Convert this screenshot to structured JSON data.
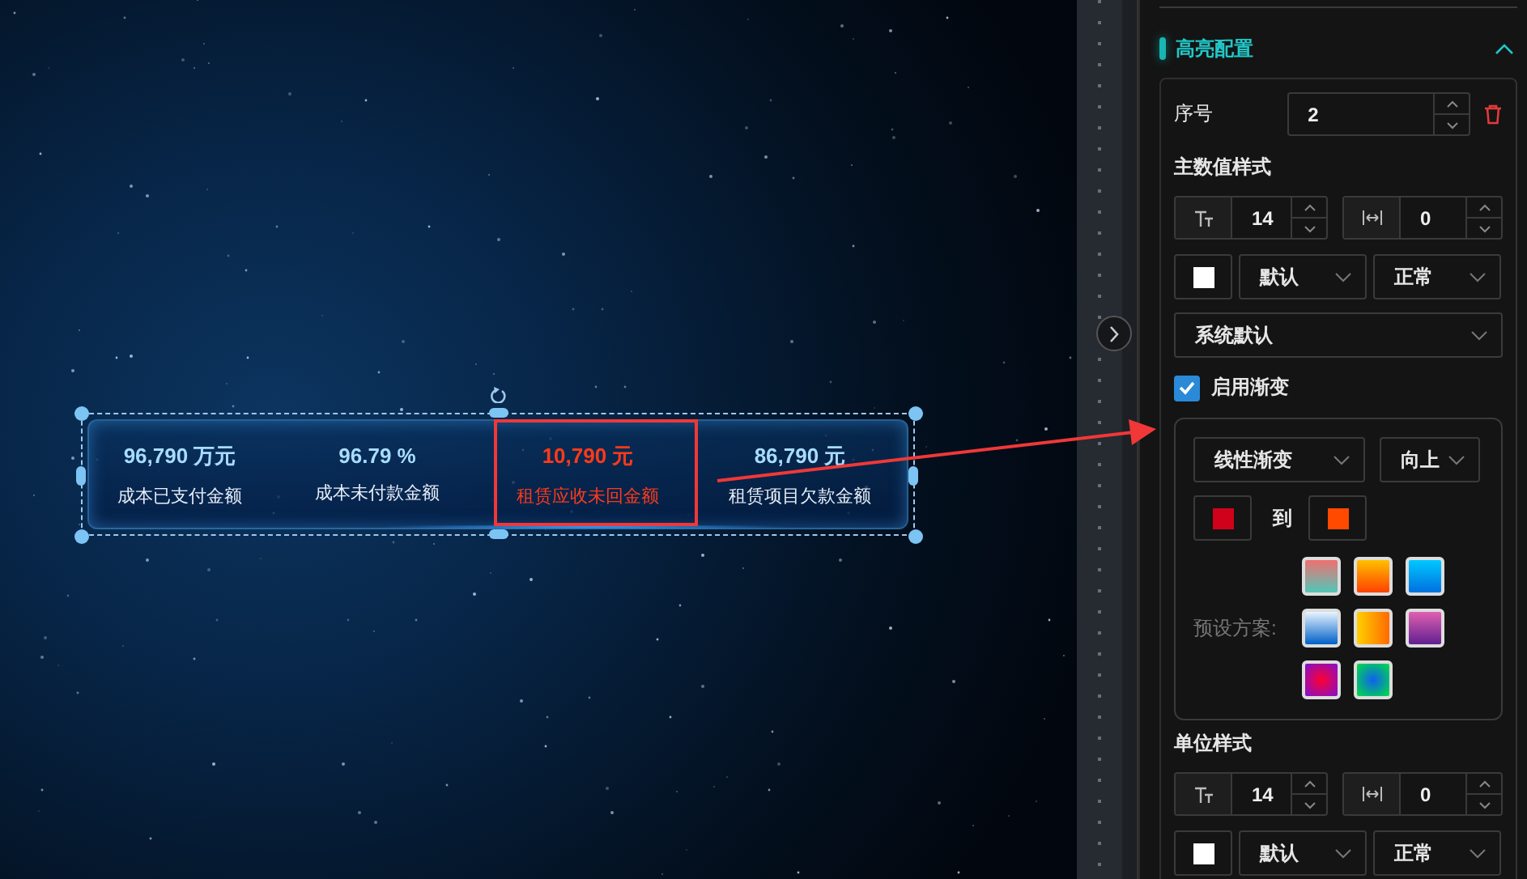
{
  "canvas": {
    "widget": {
      "items": [
        {
          "value": "96,790 万元",
          "label": "成本已支付金额",
          "highlighted": false
        },
        {
          "value": "96.79 %",
          "label": "成本未付款金额",
          "highlighted": false
        },
        {
          "value": "10,790 元",
          "label": "租赁应收未回金额",
          "highlighted": true
        },
        {
          "value": "86,790 元",
          "label": "租赁项目欠款金额",
          "highlighted": false
        }
      ]
    }
  },
  "panel": {
    "section": {
      "title": "高亮配置",
      "expanded": true
    },
    "index": {
      "label": "序号",
      "value": "2"
    },
    "main_style": {
      "title": "主数值样式",
      "font_size": "14",
      "letter_spacing": "0",
      "color": "#ffffff",
      "weight": "默认",
      "style": "正常",
      "font": "系统默认"
    },
    "gradient": {
      "label": "启用渐变",
      "checked": true,
      "type": "线性渐变",
      "direction": "向上",
      "from": {
        "color": "#d0021b"
      },
      "to_label": "到",
      "to": {
        "color": "#ff4a00"
      },
      "presets_label": "预设方案:"
    },
    "unit_style": {
      "title": "单位样式",
      "font_size": "14",
      "letter_spacing": "0",
      "color": "#ffffff",
      "weight": "默认",
      "style": "正常"
    }
  }
}
